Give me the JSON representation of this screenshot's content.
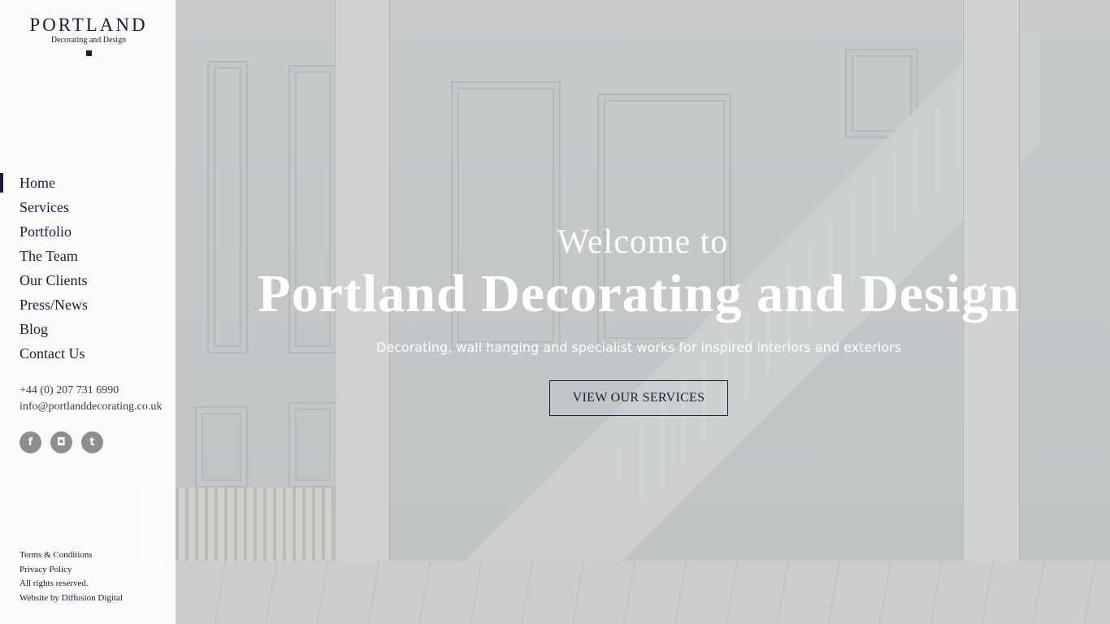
{
  "brand": {
    "name": "PORTLAND",
    "subtitle": "Decorating and Design"
  },
  "nav": {
    "items": [
      {
        "label": "Home",
        "active": true
      },
      {
        "label": "Services"
      },
      {
        "label": "Portfolio"
      },
      {
        "label": "The Team"
      },
      {
        "label": "Our Clients"
      },
      {
        "label": "Press/News"
      },
      {
        "label": "Blog"
      },
      {
        "label": "Contact Us"
      }
    ]
  },
  "contact": {
    "phone": "+44 (0) 207 731 6990",
    "email": "info@portlanddecorating.co.uk"
  },
  "social": [
    {
      "icon": "facebook-icon",
      "glyph": "f"
    },
    {
      "icon": "instagram-icon",
      "glyph": "◘"
    },
    {
      "icon": "twitter-icon",
      "glyph": "t"
    }
  ],
  "footer": {
    "terms": "Terms & Conditions",
    "privacy": "Privacy Policy",
    "rights": "All rights reserved.",
    "credit": "Website by Diffusion Digital"
  },
  "hero": {
    "welcome": "Welcome to",
    "headline": "Portland Decorating and Design",
    "tagline": "Decorating, wall hanging and specialist works for inspired interiors and exteriors",
    "cta": "VIEW OUR SERVICES"
  },
  "colors": {
    "brand_navy": "#1c1a3d",
    "social_grey": "#8e8e8e"
  }
}
